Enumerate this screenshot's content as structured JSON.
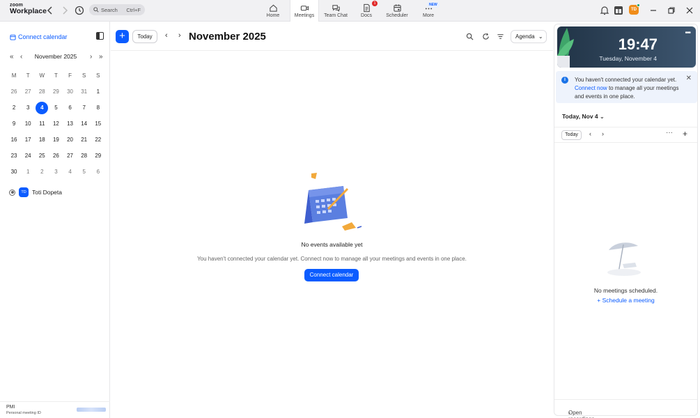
{
  "app": {
    "logo_line1": "zoom",
    "logo_line2": "Workplace",
    "search_placeholder": "Search",
    "search_shortcut": "Ctrl+F",
    "user_initials": "TD"
  },
  "nav": {
    "tabs": [
      {
        "label": "Home",
        "icon": "home-icon"
      },
      {
        "label": "Meetings",
        "icon": "video-icon",
        "active": true
      },
      {
        "label": "Team Chat",
        "icon": "chat-icon"
      },
      {
        "label": "Docs",
        "icon": "docs-icon",
        "badge": "1"
      },
      {
        "label": "Scheduler",
        "icon": "scheduler-icon"
      },
      {
        "label": "More",
        "icon": "more-icon",
        "tag": "NEW"
      }
    ]
  },
  "sidebar": {
    "connect_label": "Connect calendar",
    "mini_calendar": {
      "month_label": "November 2025",
      "weekdays": [
        "M",
        "T",
        "W",
        "T",
        "F",
        "S",
        "S"
      ],
      "weeks": [
        [
          "26",
          "27",
          "28",
          "29",
          "30",
          "31",
          "1"
        ],
        [
          "2",
          "3",
          "4",
          "5",
          "6",
          "7",
          "8"
        ],
        [
          "9",
          "10",
          "11",
          "12",
          "13",
          "14",
          "15"
        ],
        [
          "16",
          "17",
          "18",
          "19",
          "20",
          "21",
          "22"
        ],
        [
          "23",
          "24",
          "25",
          "26",
          "27",
          "28",
          "29"
        ],
        [
          "30",
          "1",
          "2",
          "3",
          "4",
          "5",
          "6"
        ]
      ],
      "today": "4"
    },
    "calendar_owner": {
      "initials": "TD",
      "name": "Toti Dopeta"
    },
    "pmi_label": "PMI",
    "pmi_sub": "Personal meeting ID"
  },
  "main": {
    "today_label": "Today",
    "month_title": "November 2025",
    "view_label": "Agenda",
    "empty_title": "No events available yet",
    "empty_subtitle": "You haven't connected your calendar yet. Connect now to manage all your meetings and events in one place.",
    "cta_label": "Connect calendar"
  },
  "right_panel": {
    "clock_time": "19:47",
    "clock_date": "Tuesday, November 4",
    "notice_prefix": "You haven't connected your calendar yet.",
    "notice_link": "Connect now",
    "notice_suffix": "to manage all your meetings and events in one place.",
    "day_label": "Today, Nov 4",
    "today_label": "Today",
    "empty_label": "No meetings scheduled.",
    "schedule_label": "Schedule a meeting",
    "recordings_label": "Open recordings"
  },
  "colors": {
    "accent": "#0b5cff",
    "clock_bg": "#2b3f54",
    "notice_bg": "#eef3fc"
  }
}
